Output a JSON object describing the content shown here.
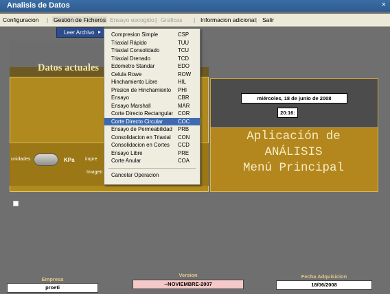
{
  "window": {
    "title": "Analisis de Datos",
    "close_glyph": "×"
  },
  "menubar": [
    {
      "label": "Configuracion",
      "state": "normal"
    },
    {
      "label": "Gestión de Ficheros",
      "state": "active"
    },
    {
      "label": "Ensayo escogido",
      "state": "disabled"
    },
    {
      "label": "Graficas",
      "state": "disabled"
    },
    {
      "label": "Informacion adicional",
      "state": "normal"
    },
    {
      "label": "Salir",
      "state": "normal"
    }
  ],
  "submenu": {
    "label": "Leer Archivo",
    "arrow": "▸"
  },
  "dropdown": {
    "items": [
      {
        "label": "Compresion Simple",
        "key": "CSP"
      },
      {
        "label": "Triaxial Rápido",
        "key": "TUU"
      },
      {
        "label": "Triaxial Consolidado",
        "key": "TCU"
      },
      {
        "label": "Triaxial Drenado",
        "key": "TCD"
      },
      {
        "label": "Edometro Standar",
        "key": "EDO"
      },
      {
        "label": "Celula Rowe",
        "key": "ROW"
      },
      {
        "label": "Hinchamiento Libre",
        "key": "HIL"
      },
      {
        "label": "Presion de Hinchamiento",
        "key": "PHI"
      },
      {
        "label": "Ensayo",
        "key": "CBR"
      },
      {
        "label": "Ensayo Marshall",
        "key": "MAR"
      },
      {
        "label": "Corte Directo Rectangular",
        "key": "COR"
      },
      {
        "label": "Corte Directo Circular",
        "key": "COC",
        "highlighted": true
      },
      {
        "label": "Ensayo de Permeabilidad",
        "key": "PRB"
      },
      {
        "label": "Consolidacion en Triaxial",
        "key": "CON"
      },
      {
        "label": "Consolidacion en Cortes",
        "key": "CCD"
      },
      {
        "label": "Ensayo Libre",
        "key": "PRE"
      },
      {
        "label": "Corte Anular",
        "key": "COA"
      }
    ],
    "cancel": "Cancelar Operacion"
  },
  "left_panel": {
    "heading": "Datos actuales",
    "fragment_left": "unidades",
    "units": "KPa",
    "fragment_impre": "impre",
    "fragment_imagen": "Imagen"
  },
  "right_panel": {
    "date": "miércoles, 18 de junio de 2008",
    "time": "20:16:",
    "title_lines": [
      "Aplicación de",
      "ANÁLISIS",
      "Menú Principal"
    ]
  },
  "footer": {
    "empresa_label": "Empresa",
    "empresa_value": "proeti",
    "version_label": "Version",
    "version_value": "--NOVIEMBRE-2007",
    "fecha_label": "Fecha Adquisicion",
    "fecha_value": "18/06/2008"
  },
  "colors": {
    "background": "#6f6f6f",
    "panel_gold": "#b3871d",
    "menu_highlight": "#3e6bb0",
    "title_text": "#f5edc8",
    "version_box": "#f6c9c9"
  }
}
